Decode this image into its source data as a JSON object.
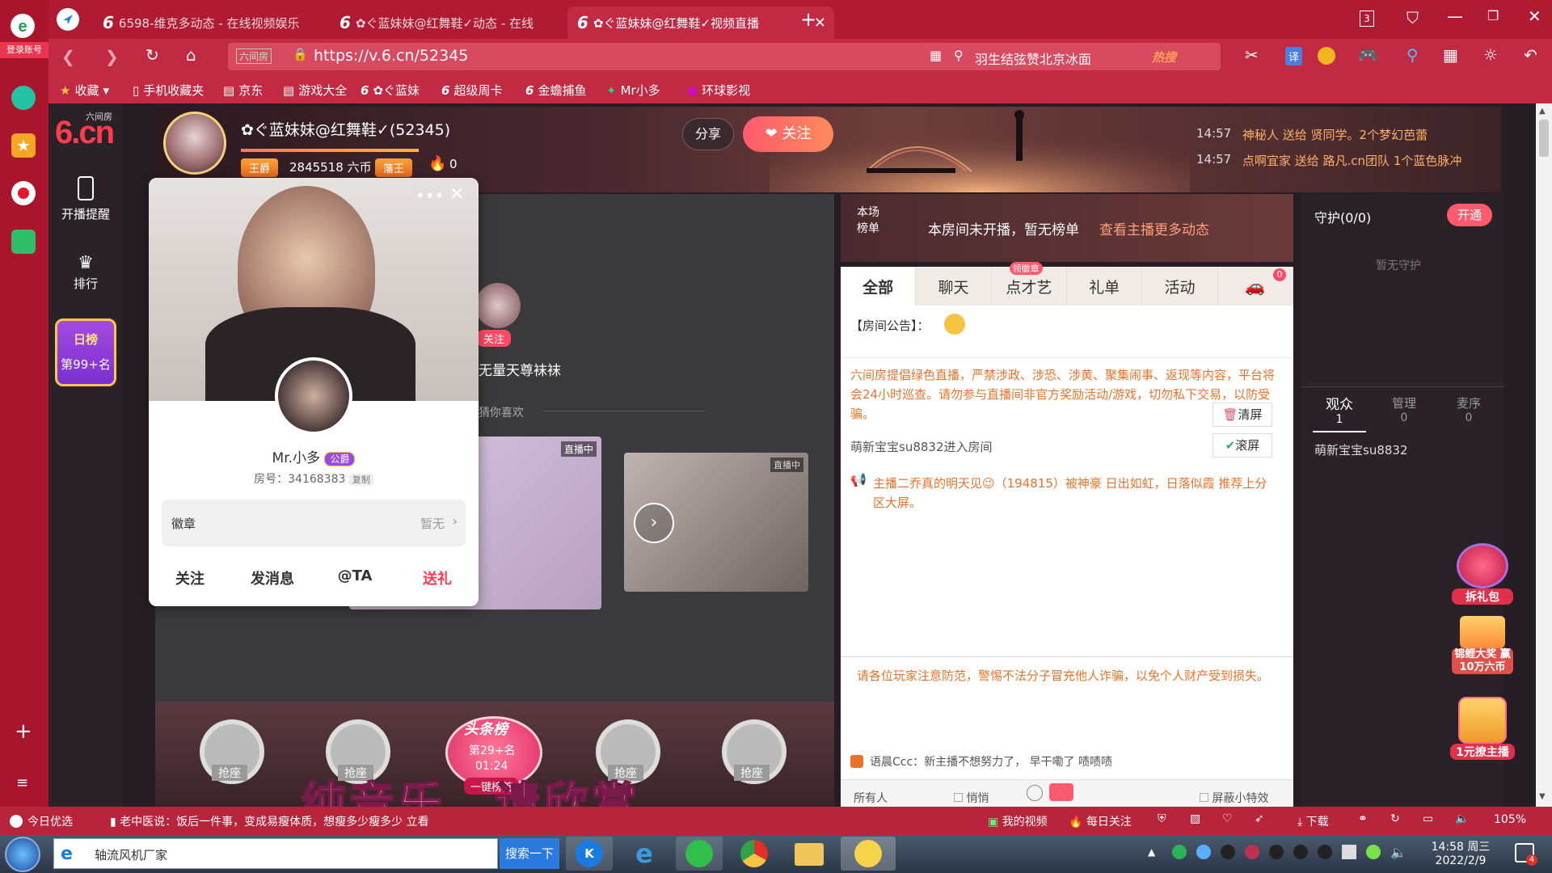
{
  "browser": {
    "login_label": "登录账号",
    "tabs": [
      {
        "label": "6598-维克多动态 - 在线视频娱乐"
      },
      {
        "label": "✿ぐ蓝妹妹@红舞鞋✓动态 - 在线"
      },
      {
        "label": "✿ぐ蓝妹妹@红舞鞋✓视频直播"
      }
    ],
    "tab_count": "3",
    "url_badge": "六间房",
    "url": "https://v.6.cn/52345",
    "search_text": "羽生结弦赞北京冰面",
    "search_hot": "热搜",
    "translate_label": "译",
    "bookmarks": [
      "收藏",
      "手机收藏夹",
      "京东",
      "游戏大全",
      "✿ぐ蓝妹",
      "超级周卡",
      "金蟾捕鱼",
      "Mr小多",
      "环球影视"
    ]
  },
  "site": {
    "logo_main": "6.cn",
    "logo_small": "六间房",
    "nav": [
      {
        "label": "开播提醒",
        "icon": "phone-icon"
      },
      {
        "label": "排行",
        "icon": "crown-icon"
      }
    ],
    "daily_rank_title": "日榜",
    "daily_rank_value": "第99+名"
  },
  "anchor": {
    "name": "✿ぐ蓝妹妹@红舞鞋✓(52345)",
    "level_badge": "王爵",
    "coins": "2845518 六币",
    "fan_badge": "藩王",
    "fire_count": "0",
    "share_label": "分享",
    "follow_label": "关注"
  },
  "gift_ticker": [
    {
      "time": "14:57",
      "text": "神秘人 送给 贤同学。2个梦幻芭蕾"
    },
    {
      "time": "14:57",
      "text": "点啊宜家 送给 路凡.cn团队 1个蓝色脉冲"
    }
  ],
  "rank_strip": {
    "tag_line1": "本场",
    "tag_line2": "榜单",
    "message": "本房间未开播，暂无榜单",
    "link": "查看主播更多动态"
  },
  "guard": {
    "title": "守护(0/0)",
    "open_label": "开通",
    "empty_text": "暂无守护"
  },
  "audience": {
    "tabs": [
      {
        "label": "观众",
        "count": "1"
      },
      {
        "label": "管理",
        "count": "0"
      },
      {
        "label": "麦序",
        "count": "0"
      }
    ],
    "users": [
      "萌新宝宝su8832"
    ]
  },
  "chat": {
    "tabs": [
      "全部",
      "聊天",
      "点才艺",
      "礼单",
      "活动"
    ],
    "talent_badge": "领徽章",
    "car_badge": "0",
    "announcement_label": "【房间公告】：",
    "notice": "六间房提倡绿色直播，严禁涉政、涉恐、涉黄、聚集闹事、返现等内容，平台将会24小时巡查。请勿参与直播间非官方奖励活动/游戏，切勿私下交易，以防受骗。",
    "clear_label": "清屏",
    "scroll_label": "滚屏",
    "enter_msg": "萌新宝宝su8832进入房间",
    "system_msg": "主播二乔真的明天见😉（194815）被神豪 日出如虹，日落似霞 推荐上分区大屏。",
    "warning": "请各位玩家注意防范，警惕不法分子冒充他人诈骗，以免个人财产受到损失。",
    "ticker": "语晨Ccc：新主播不想努力了， 早干嘞了 啧啧啧",
    "target": "所有人",
    "whisper": "悄悄",
    "block_effects": "屏蔽小特效"
  },
  "popup": {
    "name": "Mr.小多",
    "rank_badge": "公爵",
    "room_label": "房号：34168383",
    "copy_label": "复制",
    "badge_label": "徽章",
    "badge_value": "暂无",
    "actions": [
      "关注",
      "发消息",
      "@TA",
      "送礼"
    ]
  },
  "video_area": {
    "follow_tag": "关注",
    "suggest_name": "无量天尊袜袜",
    "guess_like": "猜你喜欢",
    "live_tag": "直播中",
    "live_tag2": "直播中"
  },
  "seats": {
    "grab_label": "抢座",
    "toutiao_title": "头条榜",
    "toutiao_rank": "第29+名",
    "toutiao_time": "01:24",
    "toutiao_btn": "一键榜首"
  },
  "subtitle": "纯音乐，请欣赏",
  "promos": [
    "拆礼包",
    "锦鲤大奖 赢10万六币",
    "1元撩主播"
  ],
  "statusbar": {
    "today": "今日优选",
    "news": "老中医说：饭后一件事，变成易瘦体质，想瘦多少瘦多少",
    "news_btn": "立看",
    "my_video": "我的视频",
    "daily_follow": "每日关注",
    "download": "下载",
    "zoom": "105%"
  },
  "taskbar": {
    "app_title": "轴流风机厂家",
    "search_btn": "搜索一下",
    "time": "14:58 周三",
    "date": "2022/2/9",
    "notif_count": "4"
  }
}
